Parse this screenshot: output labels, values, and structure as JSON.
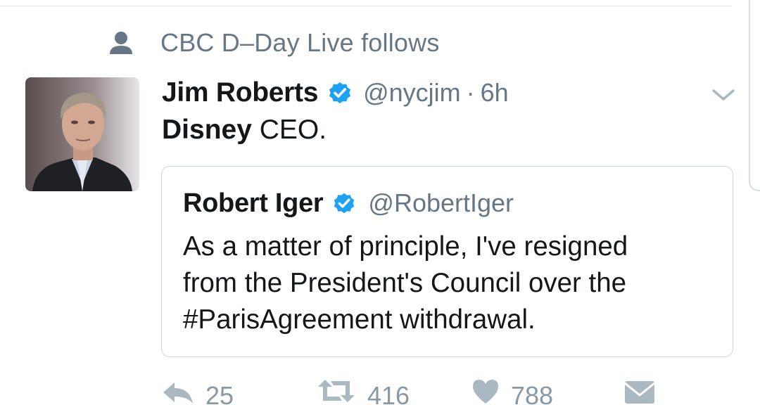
{
  "context": {
    "icon": "person-icon",
    "text": "CBC D–Day Live follows"
  },
  "tweet": {
    "display_name": "Jim Roberts",
    "verified_icon": "verified-badge-icon",
    "handle": "@nycjim",
    "separator": "·",
    "timestamp": "6h",
    "text_bold": "Disney",
    "text_rest": " CEO."
  },
  "quoted": {
    "display_name": "Robert Iger",
    "handle": "@RobertIger",
    "lines": [
      "As a matter of principle, I've resigned",
      "from the President's Council over the",
      "#ParisAgreement withdrawal."
    ]
  },
  "actions": {
    "reply_count": "25",
    "retweet_count": "416",
    "like_count": "788"
  },
  "colors": {
    "verified_blue": "#1da1f2",
    "muted_text": "#657786",
    "action_gray": "#8899a6"
  }
}
